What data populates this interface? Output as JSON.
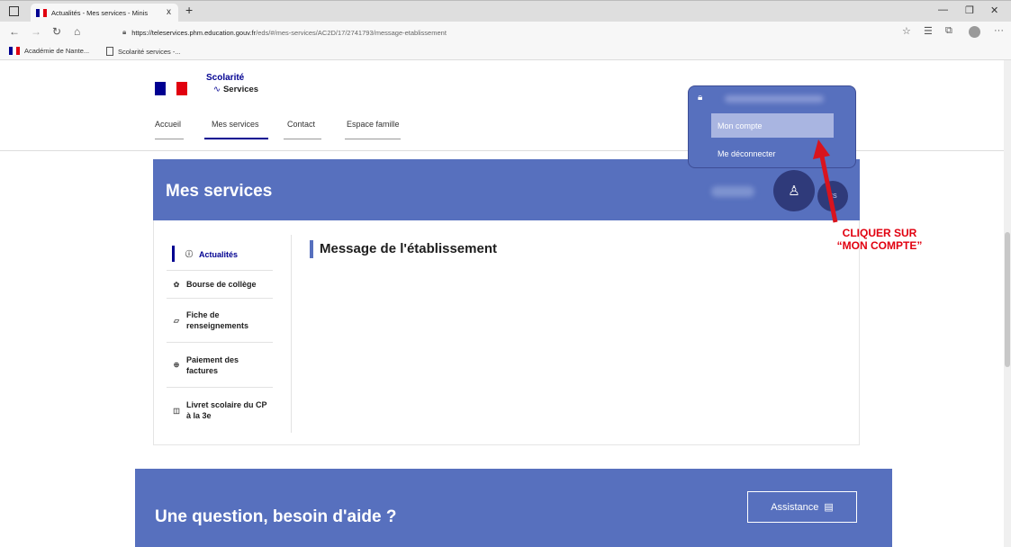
{
  "browser": {
    "tab_title": "Actualités - Mes services - Minis",
    "tab_close": "x",
    "new_tab": "+",
    "url_host": "https://teleservices.phm.education.gouv.fr",
    "url_path": "/eds/#/mes-services/AC2D/17/2741793/message-etablissement",
    "bookmarks": [
      {
        "label": "Académie de Nante..."
      },
      {
        "label": "Scolarité services -..."
      }
    ]
  },
  "header": {
    "logo_line1": "Scolarité",
    "logo_line2": "Services",
    "nav": [
      {
        "label": "Accueil"
      },
      {
        "label": "Mes services"
      },
      {
        "label": "Contact"
      },
      {
        "label": "Espace famille"
      }
    ]
  },
  "banner": {
    "title": "Mes services",
    "user_initials": "ES"
  },
  "account_menu": {
    "items": [
      {
        "label": "Mon compte"
      },
      {
        "label": "Me déconnecter"
      }
    ]
  },
  "sidebar": {
    "items": [
      {
        "label": "Actualités",
        "icon": "info-icon"
      },
      {
        "label": "Bourse de collège",
        "icon": "bourse-icon"
      },
      {
        "label": "Fiche de renseignements",
        "icon": "document-icon"
      },
      {
        "label": "Paiement des factures",
        "icon": "payment-icon"
      },
      {
        "label": "Livret scolaire du CP à la 3e",
        "icon": "book-icon"
      }
    ]
  },
  "main": {
    "message_title": "Message de l'établissement"
  },
  "annotation": {
    "line1": "CLIQUER SUR",
    "line2": "“MON COMPTE”"
  },
  "help": {
    "title": "Une question, besoin d'aide ?",
    "assist_label": "Assistance"
  },
  "colors": {
    "brand_blue": "#000091",
    "banner_blue": "#5770be",
    "annotation_red": "#e1000f"
  }
}
